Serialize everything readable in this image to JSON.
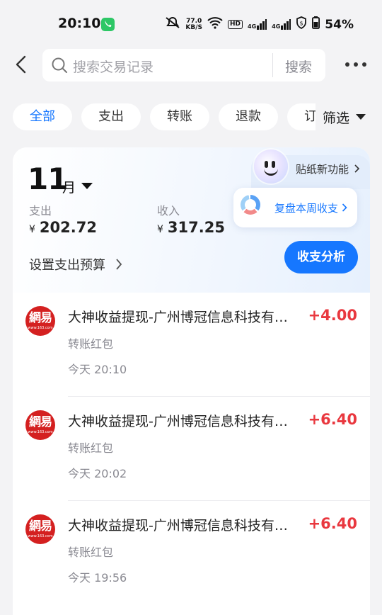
{
  "status_bar": {
    "time": "20:10",
    "net_speed_value": "77.0",
    "net_speed_unit": "KB/S",
    "hd_label": "HD",
    "signal_1": "4G",
    "signal_2": "4G",
    "battery": "54%",
    "icons": [
      "call-active-icon",
      "mute-icon",
      "wifi-icon",
      "signal-icon",
      "shield-icon",
      "battery-icon"
    ]
  },
  "header": {
    "search_placeholder": "搜索交易记录",
    "search_button": "搜索"
  },
  "tabs": [
    {
      "label": "全部",
      "active": true
    },
    {
      "label": "支出",
      "active": false
    },
    {
      "label": "转账",
      "active": false
    },
    {
      "label": "退款",
      "active": false
    },
    {
      "label": "订单",
      "active": false
    }
  ],
  "filter_label": "筛选",
  "summary": {
    "month_number": "11",
    "month_unit": "月",
    "sticker_label": "贴纸新功能",
    "review_label": "复盘本周收支",
    "expense_label": "支出",
    "expense_currency": "¥",
    "expense_amount": "202.72",
    "income_label": "收入",
    "income_currency": "¥",
    "income_amount": "317.25",
    "budget_label": "设置支出预算",
    "analyze_button": "收支分析"
  },
  "transactions": [
    {
      "logo_main": "網易",
      "logo_sub": "www.163.com",
      "title": "大神收益提现-广州博冠信息科技有…",
      "amount": "+4.00",
      "category": "转账红包",
      "time": "今天 20:10"
    },
    {
      "logo_main": "網易",
      "logo_sub": "www.163.com",
      "title": "大神收益提现-广州博冠信息科技有…",
      "amount": "+6.40",
      "category": "转账红包",
      "time": "今天 20:02"
    },
    {
      "logo_main": "網易",
      "logo_sub": "www.163.com",
      "title": "大神收益提现-广州博冠信息科技有…",
      "amount": "+6.40",
      "category": "转账红包",
      "time": "今天 19:56"
    }
  ],
  "colors": {
    "accent": "#1677ff",
    "income": "#e9383f",
    "logo_red": "#d42020",
    "background": "#f3f3f5"
  }
}
